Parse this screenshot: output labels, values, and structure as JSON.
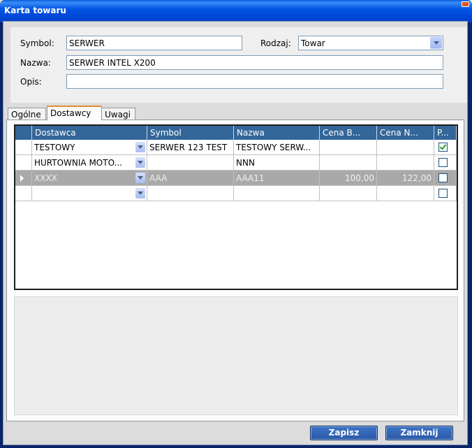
{
  "window": {
    "title": "Karta towaru"
  },
  "form": {
    "symbol_label": "Symbol:",
    "symbol_value": "SERWER",
    "rodzaj_label": "Rodzaj:",
    "rodzaj_value": "Towar",
    "nazwa_label": "Nazwa:",
    "nazwa_value": "SERWER INTEL X200",
    "opis_label": "Opis:",
    "opis_value": ""
  },
  "tabs": [
    {
      "label": "Ogólne",
      "active": false
    },
    {
      "label": "Dostawcy",
      "active": true
    },
    {
      "label": "Uwagi",
      "active": false
    }
  ],
  "grid": {
    "columns": [
      "Dostawca",
      "Symbol",
      "Nazwa",
      "Cena B...",
      "Cena N...",
      "P..."
    ],
    "rows": [
      {
        "dostawca": "TESTOWY",
        "symbol": "SERWER 123 TEST",
        "nazwa": "TESTOWY SERW...",
        "cena_b": "",
        "cena_n": "",
        "checked": true,
        "selected": false
      },
      {
        "dostawca": "HURTOWNIA MOTO...",
        "symbol": "",
        "nazwa": "NNN",
        "cena_b": "",
        "cena_n": "",
        "checked": false,
        "selected": false
      },
      {
        "dostawca": "XXXX",
        "symbol": "AAA",
        "nazwa": "AAA11",
        "cena_b": "100,00",
        "cena_n": "122,00",
        "checked": false,
        "selected": true
      },
      {
        "dostawca": "",
        "symbol": "",
        "nazwa": "",
        "cena_b": "",
        "cena_n": "",
        "checked": false,
        "selected": false
      }
    ]
  },
  "buttons": {
    "save": "Zapisz",
    "close": "Zamknij"
  },
  "colors": {
    "grid_header": "#336699",
    "selected_row": "#a9a9a9",
    "active_tab_accent": "#e68b2c"
  }
}
